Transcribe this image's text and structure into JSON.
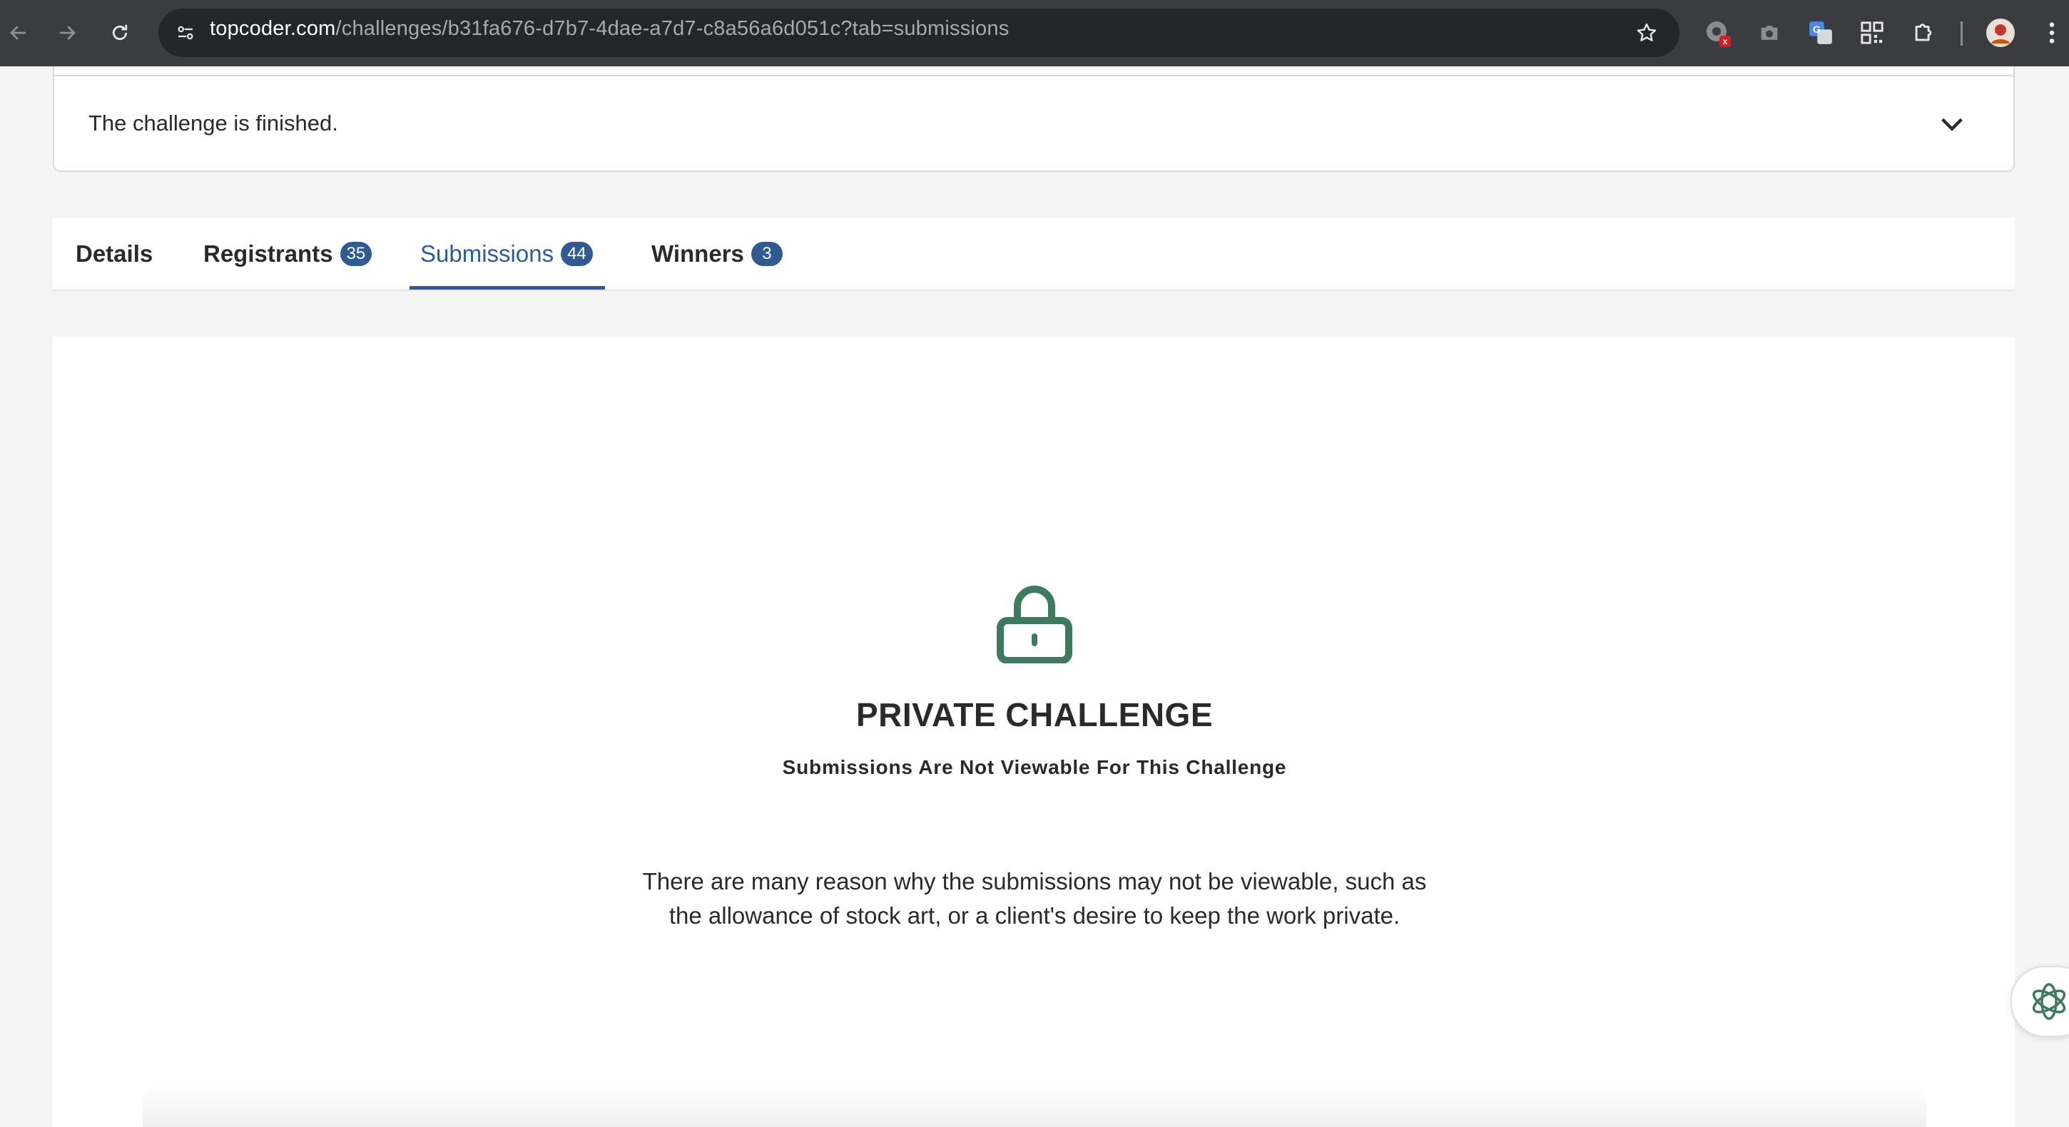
{
  "browser": {
    "url_domain": "topcoder.com",
    "url_path": "/challenges/b31fa676-d7b7-4dae-a7d7-c8a56a6d051c?tab=submissions"
  },
  "status": {
    "text": "The challenge is finished."
  },
  "tabs": [
    {
      "label": "Details",
      "count": null
    },
    {
      "label": "Registrants",
      "count": "35"
    },
    {
      "label": "Submissions",
      "count": "44"
    },
    {
      "label": "Winners",
      "count": "3"
    }
  ],
  "active_tab": "Submissions",
  "main": {
    "title": "PRIVATE CHALLENGE",
    "subtitle": "Submissions Are Not Viewable For This Challenge",
    "description": "There are many reason why the submissions may not be viewable, such as the allowance of stock art, or a client's desire to keep the work private."
  },
  "colors": {
    "accent": "#2b5b9e",
    "badge": "#2f5a92",
    "lock": "#3d7a5e"
  },
  "icons": [
    "back-icon",
    "forward-icon",
    "reload-icon",
    "site-settings-icon",
    "star-icon",
    "extension-icon",
    "camera-icon",
    "translate-icon",
    "qr-code-icon",
    "puzzle-icon",
    "profile-avatar",
    "menu-icon",
    "chevron-down-icon",
    "lock-icon",
    "assistant-icon"
  ]
}
